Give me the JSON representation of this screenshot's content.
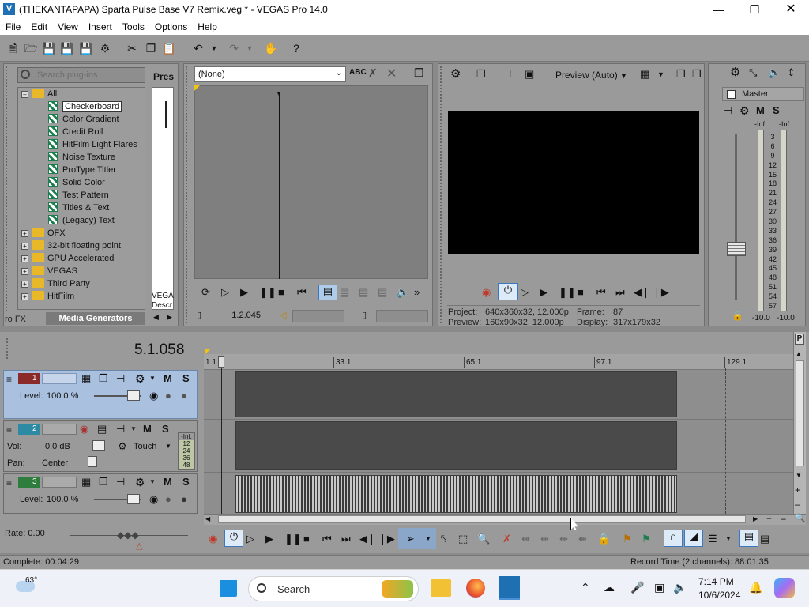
{
  "window": {
    "title": "(THEKANTAPAPA) Sparta Pulse Base V7 Remix.veg * - VEGAS Pro 14.0"
  },
  "menu": [
    "File",
    "Edit",
    "View",
    "Insert",
    "Tools",
    "Options",
    "Help"
  ],
  "explorer": {
    "search_placeholder": "Search plug-ins",
    "root": "All",
    "generators": [
      "Checkerboard",
      "Color Gradient",
      "Credit Roll",
      "HitFilm Light Flares",
      "Noise Texture",
      "ProType Titler",
      "Solid Color",
      "Test Pattern",
      "Titles & Text",
      "(Legacy) Text"
    ],
    "folders": [
      "OFX",
      "32-bit floating point",
      "GPU Accelerated",
      "VEGAS",
      "Third Party",
      "HitFilm"
    ],
    "presets_header": "Pres",
    "presets_footer": "VEGA Descr",
    "tabs": [
      "ro FX",
      "Media Generators"
    ]
  },
  "trimmer": {
    "dropdown": "(None)",
    "time": "1.2.045"
  },
  "preview": {
    "mode": "Preview (Auto)",
    "project_label": "Project:",
    "project_value": "640x360x32, 12.000p",
    "preview_label": "Preview:",
    "preview_value": "160x90x32, 12.000p",
    "frame_label": "Frame:",
    "frame_value": "87",
    "display_label": "Display:",
    "display_value": "317x179x32"
  },
  "mixer": {
    "master": "Master",
    "peak_left": "-Inf.",
    "peak_right": "-Inf.",
    "scale": [
      "3",
      "6",
      "9",
      "12",
      "15",
      "18",
      "21",
      "24",
      "27",
      "30",
      "33",
      "36",
      "39",
      "42",
      "45",
      "48",
      "51",
      "54",
      "57"
    ],
    "level_left": "-10.0",
    "level_right": "-10.0",
    "m": "M",
    "s": "S"
  },
  "timeline": {
    "cursor_time": "5.1.058",
    "ruler": [
      "1.1",
      "33.1",
      "65.1",
      "97.1",
      "129.1"
    ],
    "rate": "Rate: 0.00",
    "tracks": [
      {
        "num": "1",
        "level_label": "Level:",
        "level_value": "100.0 %"
      },
      {
        "num": "2",
        "vol_label": "Vol:",
        "vol_value": "0.0 dB",
        "pan_label": "Pan:",
        "pan_value": "Center",
        "mode": "Touch",
        "meter": [
          "-Inf.",
          "12",
          "24",
          "36",
          "48"
        ]
      },
      {
        "num": "3",
        "level_label": "Level:",
        "level_value": "100.0 %"
      }
    ],
    "m": "M",
    "s": "S"
  },
  "status": {
    "complete": "Complete: 00:04:29",
    "record": "Record Time (2 channels): 88:01:35"
  },
  "taskbar": {
    "temp": "63°",
    "search": "Search",
    "time": "7:14 PM",
    "date": "10/6/2024"
  }
}
